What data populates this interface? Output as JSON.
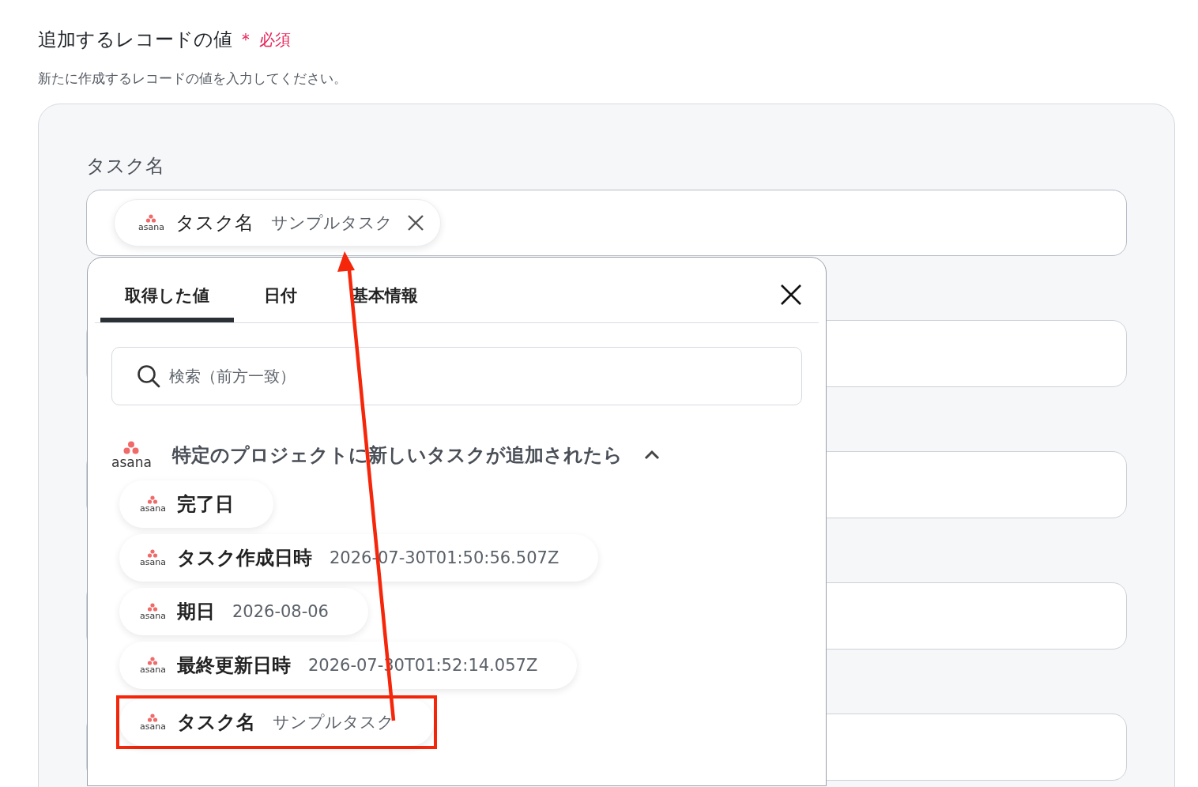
{
  "header": {
    "title": "追加するレコードの値",
    "required_mark": "＊",
    "required_label": "必須",
    "description": "新たに作成するレコードの値を入力してください。"
  },
  "field": {
    "label": "タスク名",
    "chips": [
      {
        "app": "asana",
        "name": "タスク名",
        "value": "サンプルタスク"
      }
    ]
  },
  "picker": {
    "tabs": [
      {
        "label": "取得した値",
        "selected": true
      },
      {
        "label": "日付",
        "selected": false
      },
      {
        "label": "基本情報",
        "selected": false
      }
    ],
    "search": {
      "placeholder": "検索（前方一致）"
    },
    "section": {
      "app": "asana",
      "title": "特定のプロジェクトに新しいタスクが追加されたら",
      "expanded": true
    },
    "items": [
      {
        "app": "asana",
        "name": "完了日",
        "highlighted": false
      },
      {
        "app": "asana",
        "name": "タスク作成日時",
        "value": "2026-07-30T01:50:56.507Z",
        "highlighted": false
      },
      {
        "app": "asana",
        "name": "期日",
        "value": "2026-08-06",
        "highlighted": false
      },
      {
        "app": "asana",
        "name": "最終更新日時",
        "value": "2026-07-30T01:52:14.057Z",
        "highlighted": false
      },
      {
        "app": "asana",
        "name": "タスク名",
        "value": "サンプルタスク",
        "highlighted": true
      }
    ]
  }
}
